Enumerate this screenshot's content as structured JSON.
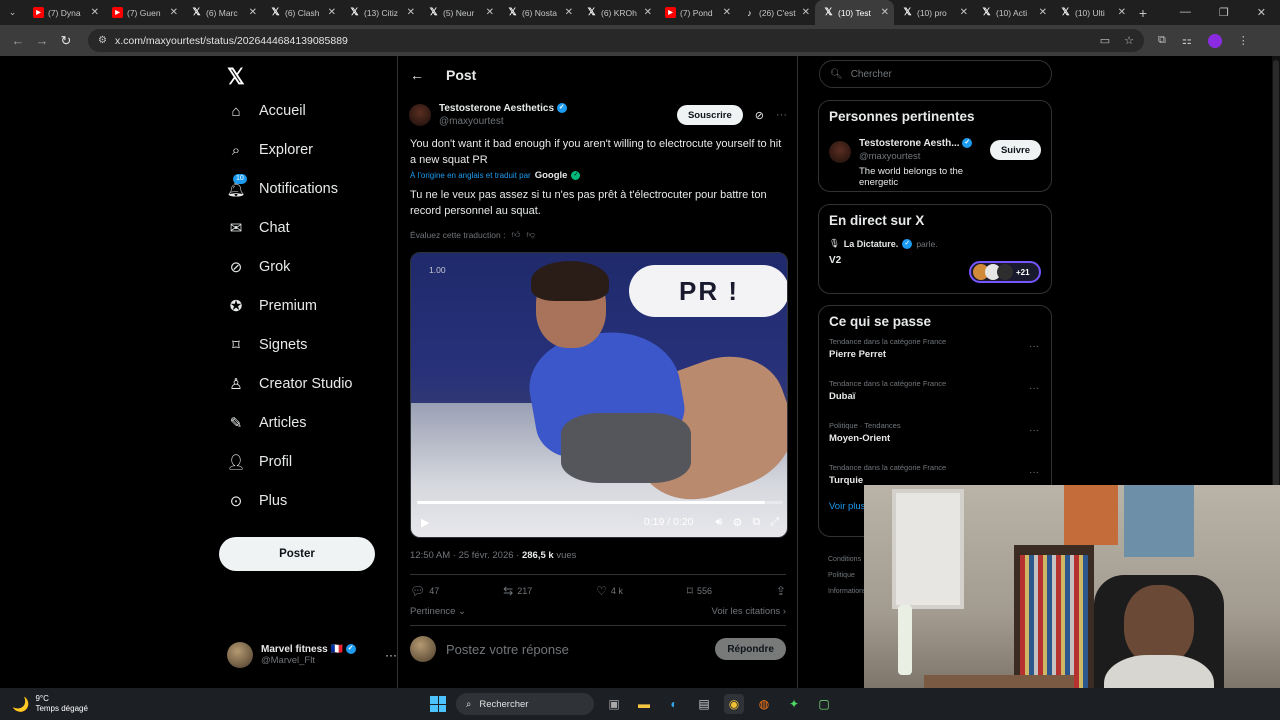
{
  "browser": {
    "tabs": [
      {
        "icon": "youtube-icon",
        "label": "(7) Dyna"
      },
      {
        "icon": "youtube-icon",
        "label": "(7) Guen"
      },
      {
        "icon": "x-icon",
        "label": "(6) Marc"
      },
      {
        "icon": "x-icon",
        "label": "(6) Clash"
      },
      {
        "icon": "x-icon",
        "label": "(13) Citiz"
      },
      {
        "icon": "x-icon",
        "label": "(5) Neur"
      },
      {
        "icon": "x-icon",
        "label": "(6) Nosta"
      },
      {
        "icon": "x-icon",
        "label": "(6) KROh"
      },
      {
        "icon": "youtube-icon",
        "label": "(7) Pond"
      },
      {
        "icon": "tiktok-icon",
        "label": "(26) C'est"
      },
      {
        "icon": "x-icon",
        "label": "(10) Test",
        "active": true
      },
      {
        "icon": "x-icon",
        "label": "(10) pro"
      },
      {
        "icon": "x-icon",
        "label": "(10) Acti"
      },
      {
        "icon": "x-icon",
        "label": "(10) Ulti"
      }
    ],
    "url": "x.com/maxyourtest/status/2026444684139085889"
  },
  "nav": {
    "items": [
      {
        "label": "Accueil",
        "icon": "home-icon"
      },
      {
        "label": "Explorer",
        "icon": "search-icon"
      },
      {
        "label": "Notifications",
        "icon": "bell-icon",
        "badge": "10"
      },
      {
        "label": "Chat",
        "icon": "mail-icon"
      },
      {
        "label": "Grok",
        "icon": "grok-icon"
      },
      {
        "label": "Premium",
        "icon": "premium-icon"
      },
      {
        "label": "Signets",
        "icon": "bookmark-icon"
      },
      {
        "label": "Creator Studio",
        "icon": "creator-icon"
      },
      {
        "label": "Articles",
        "icon": "articles-icon"
      },
      {
        "label": "Profil",
        "icon": "profile-icon"
      },
      {
        "label": "Plus",
        "icon": "more-icon"
      }
    ],
    "post_button": "Poster",
    "account": {
      "name": "Marvel fitness 🇫🇷",
      "handle": "@Marvel_Flt"
    }
  },
  "post": {
    "header_title": "Post",
    "author_name": "Testosterone Aesthetics",
    "author_handle": "@maxyourtest",
    "subscribe_label": "Souscrire",
    "text": "You don't want it bad enough if you aren't willing to electrocute yourself to hit a new squat PR",
    "translated_note": "À l'origine en anglais et traduit par",
    "translated_by": "Google",
    "translation": "Tu ne le veux pas assez si tu n'es pas prêt à t'électrocuter pour battre ton record personnel au squat.",
    "rate_translation": "Évaluez cette traduction :",
    "video": {
      "bubble_text": "PR !",
      "speed": "1.00",
      "time": "0:19 / 0:20",
      "progress": 0.95
    },
    "timestamp": "12:50 AM · 25 févr. 2026 ·",
    "views_count": "286,5 k",
    "views_label": "vues",
    "replies": "47",
    "reposts": "217",
    "likes": "4 k",
    "bookmarks": "556",
    "sort_label": "Pertinence",
    "quotes_label": "Voir les citations",
    "reply_placeholder": "Postez votre réponse",
    "reply_button": "Répondre"
  },
  "right": {
    "search_placeholder": "Chercher",
    "relevant": {
      "title": "Personnes pertinentes",
      "name": "Testosterone Aesth...",
      "handle": "@maxyourtest",
      "bio": "The world belongs to the energetic",
      "follow_label": "Suivre"
    },
    "live": {
      "title": "En direct sur X",
      "host": "La Dictature.",
      "host_action": "parle.",
      "space_title": "V2",
      "count": "+21"
    },
    "trends": {
      "title": "Ce qui se passe",
      "items": [
        {
          "category": "Tendance dans la catégorie France",
          "name": "Pierre Perret"
        },
        {
          "category": "Tendance dans la catégorie France",
          "name": "Dubaï"
        },
        {
          "category": "Politique · Tendances",
          "name": "Moyen-Orient"
        },
        {
          "category": "Tendance dans la catégorie France",
          "name": "Turquie"
        }
      ],
      "show_more": "Voir plus"
    },
    "footer": [
      "Conditions",
      "Politique",
      "Informations"
    ]
  },
  "taskbar": {
    "temperature": "9°C",
    "weather": "Temps dégagé",
    "search": "Rechercher"
  }
}
